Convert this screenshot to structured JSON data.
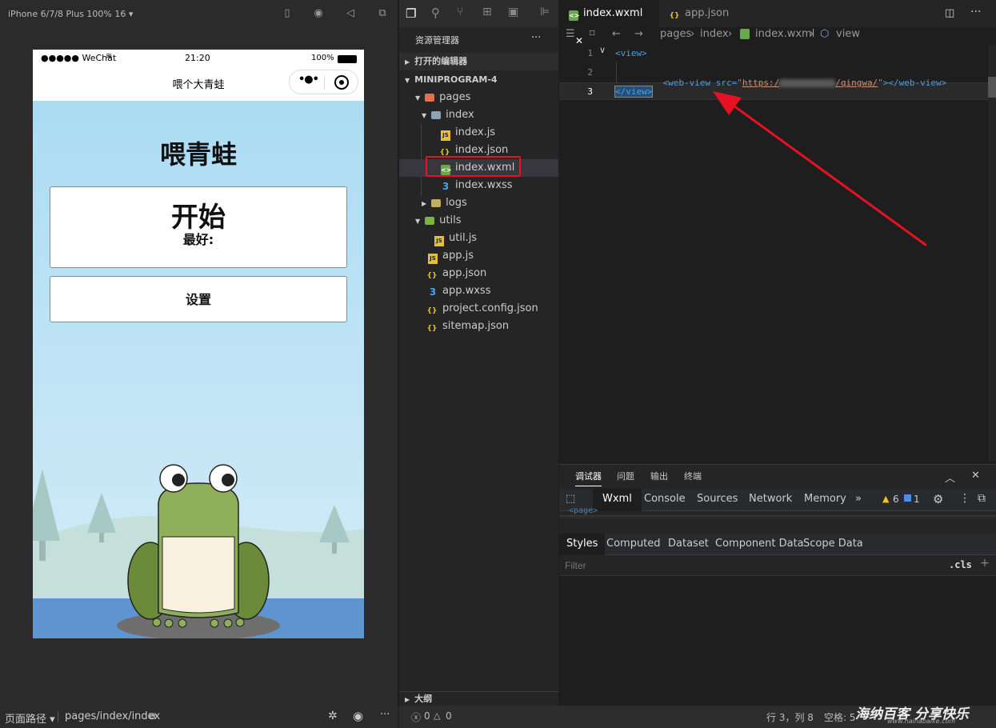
{
  "simulator": {
    "device": "iPhone 6/7/8 Plus 100% 16 ▾",
    "status_carrier": "●●●●● WeChat",
    "status_time": "21:20",
    "status_battery": "100%",
    "nav_title": "喂个大青蛙",
    "page_title": "喂青蛙",
    "start_label": "开始",
    "best_label": "最好:",
    "settings_label": "设置"
  },
  "explorer": {
    "title": "资源管理器",
    "more": "···",
    "open_editors": "打开的编辑器",
    "project": "MINIPROGRAM-4",
    "items": [
      {
        "label": "pages",
        "icon": "folder-icon"
      },
      {
        "label": "index",
        "icon": "folder-icon"
      },
      {
        "label": "index.js",
        "icon": "js-file-icon"
      },
      {
        "label": "index.json",
        "icon": "json-file-icon"
      },
      {
        "label": "index.wxml",
        "icon": "wxml-file-icon"
      },
      {
        "label": "index.wxss",
        "icon": "css-file-icon"
      },
      {
        "label": "logs",
        "icon": "folder-icon"
      },
      {
        "label": "utils",
        "icon": "folder-icon"
      },
      {
        "label": "util.js",
        "icon": "js-file-icon"
      },
      {
        "label": "app.js",
        "icon": "js-file-icon"
      },
      {
        "label": "app.json",
        "icon": "json-file-icon"
      },
      {
        "label": "app.wxss",
        "icon": "css-file-icon"
      },
      {
        "label": "project.config.json",
        "icon": "json-file-icon"
      },
      {
        "label": "sitemap.json",
        "icon": "json-file-icon"
      }
    ],
    "outline": "大纲"
  },
  "editor": {
    "tabs": [
      {
        "label": "index.wxml",
        "close": "✕"
      },
      {
        "label": "app.json"
      }
    ],
    "breadcrumb": [
      "pages",
      "index",
      "index.wxml",
      "view"
    ],
    "line_numbers": [
      "1",
      "2",
      "3"
    ],
    "line1": "<view>",
    "line2_open": "<web-view src=\"",
    "line2_url_start": "https:/",
    "line2_url_end": "/qingwa/",
    "line2_close": "\"></web-view>",
    "line3": "</view>"
  },
  "devtools": {
    "top_tabs": [
      "调试器",
      "问题",
      "输出",
      "终端"
    ],
    "panel_tabs": [
      "Wxml",
      "Console",
      "Sources",
      "Network",
      "Memory"
    ],
    "overflow": "»",
    "warnings": "6",
    "infos": "1",
    "peek_text": "<page>",
    "style_tabs": [
      "Styles",
      "Computed",
      "Dataset",
      "Component Data",
      "Scope Data"
    ],
    "filter_placeholder": "Filter",
    "cls": ".cls",
    "add": "+"
  },
  "statusbar": {
    "page_path_label": "页面路径 ▾",
    "page_path": "pages/index/index",
    "errors": "0",
    "warnings": "0",
    "cursor": "行 3，列 8",
    "indent": "空格: 5",
    "watermark": "海纳百客 分享快乐",
    "watermark_url": "www.hainabaike.com"
  },
  "colors": {
    "accent": "#0e639c",
    "highlight_box": "#e81123",
    "arrow": "#e81123"
  }
}
